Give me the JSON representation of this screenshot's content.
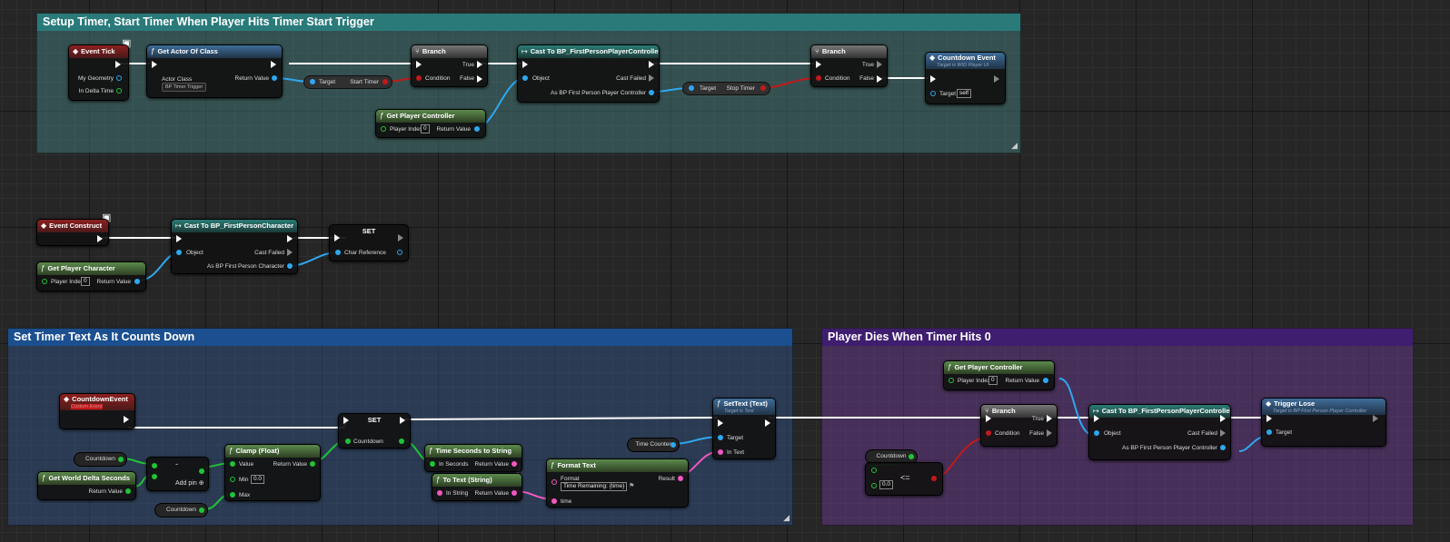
{
  "comments": {
    "setup": "Setup Timer, Start Timer When Player Hits Timer Start Trigger",
    "text": "Set Timer Text As It Counts Down",
    "dies": "Player Dies When Timer Hits 0"
  },
  "colors": {
    "setup_title": "#2a7a7a",
    "setup_body": "rgba(74,133,133,0.45)",
    "text_title": "#1b4f8f",
    "text_body": "rgba(52,86,140,0.45)",
    "dies_title": "#3f1d6f",
    "dies_body": "rgba(110,60,150,0.45)",
    "exec": "#ffffff",
    "object": "#2ea8f0",
    "float": "#1fc436",
    "bool": "#c21a1a",
    "string": "#f058c0"
  },
  "nodes": {
    "event_tick": {
      "title": "Event Tick",
      "pin1": "My Geometry",
      "pin2": "In Delta Time"
    },
    "get_actor": {
      "title": "Get Actor Of Class",
      "actor_class": "Actor Class",
      "class_value": "BP Timer Trigger",
      "return": "Return Value"
    },
    "start_timer_var": {
      "target": "Target",
      "name": "Start Timer"
    },
    "branch1": {
      "title": "Branch",
      "true": "True",
      "condition": "Condition",
      "false": "False"
    },
    "get_pc1": {
      "title": "Get Player Controller",
      "player_index": "Player Index",
      "index_value": "0",
      "return": "Return Value"
    },
    "cast_fppc1": {
      "title": "Cast To BP_FirstPersonPlayerController",
      "object": "Object",
      "cast_failed": "Cast Failed",
      "as": "As BP First Person Player Controller"
    },
    "stop_timer_var": {
      "target": "Target",
      "name": "Stop Timer"
    },
    "branch2": {
      "title": "Branch",
      "true": "True",
      "condition": "Condition",
      "false": "False"
    },
    "countdown_call": {
      "title": "Countdown Event",
      "subtitle": "Target is WID Player UI",
      "target": "Target",
      "target_value": "self"
    },
    "event_construct": {
      "title": "Event Construct"
    },
    "cast_fpc": {
      "title": "Cast To BP_FirstPersonCharacter",
      "object": "Object",
      "cast_failed": "Cast Failed",
      "as": "As BP First Person Character"
    },
    "set_char": {
      "title": "SET",
      "pin": "Char Reference"
    },
    "get_char": {
      "title": "Get Player Character",
      "player_index": "Player Index",
      "index_value": "0",
      "return": "Return Value"
    },
    "countdown_event": {
      "title": "CountdownEvent",
      "subtitle": "Custom Event"
    },
    "countdown_var1": {
      "name": "Countdown"
    },
    "world_delta": {
      "title": "Get World Delta Seconds",
      "return": "Return Value"
    },
    "subtract": {
      "op": "-",
      "add_pin": "Add pin"
    },
    "countdown_var2": {
      "name": "Countdown"
    },
    "clamp": {
      "title": "Clamp (Float)",
      "value": "Value",
      "min": "Min",
      "min_value": "0.0",
      "max": "Max",
      "return": "Return Value"
    },
    "set_countdown": {
      "title": "SET",
      "pin": "Countdown"
    },
    "time_to_string": {
      "title": "Time Seconds to String",
      "in": "In Seconds",
      "return": "Return Value"
    },
    "to_text": {
      "title": "To Text (String)",
      "in": "In String",
      "return": "Return Value"
    },
    "format_text": {
      "title": "Format Text",
      "format": "Format",
      "format_value": "Time Remaining: {time}",
      "result": "Result",
      "time": "time"
    },
    "time_counter": {
      "name": "Time Counter"
    },
    "set_text": {
      "title": "SetText (Text)",
      "subtitle": "Target is Text",
      "target": "Target",
      "in_text": "In Text"
    },
    "get_pc2": {
      "title": "Get Player Controller",
      "player_index": "Player Index",
      "index_value": "0",
      "return": "Return Value"
    },
    "branch3": {
      "title": "Branch",
      "true": "True",
      "condition": "Condition",
      "false": "False"
    },
    "countdown_var3": {
      "name": "Countdown"
    },
    "lte": {
      "value": "0.0",
      "op": "<="
    },
    "cast_fppc2": {
      "title": "Cast To BP_FirstPersonPlayerController",
      "object": "Object",
      "cast_failed": "Cast Failed",
      "as": "As BP First Person Player Controller"
    },
    "trigger_lose": {
      "title": "Trigger Lose",
      "subtitle": "Target is BP First Person Player Controller",
      "target": "Target"
    }
  },
  "icons": {
    "event": "diamond-event-icon",
    "function": "f-function-icon",
    "branch": "branch-icon",
    "cast": "cast-arrow-icon",
    "monitor": "monitor-icon"
  }
}
